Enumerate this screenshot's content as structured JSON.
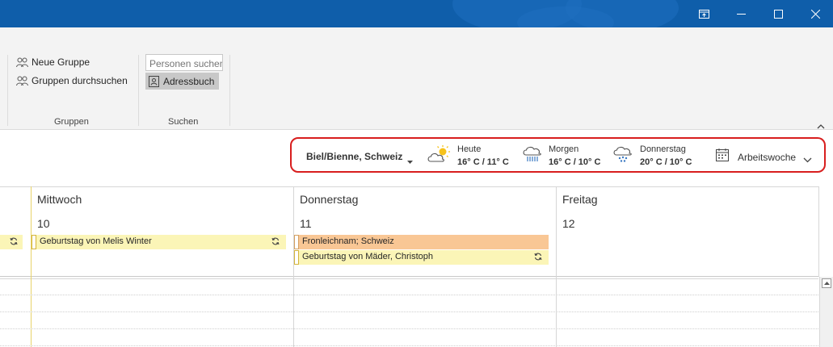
{
  "ribbon": {
    "new_group": "Neue Gruppe",
    "browse_groups": "Gruppen durchsuchen",
    "group_label_groups": "Gruppen",
    "search_people_placeholder": "Personen suchen",
    "address_book": "Adressbuch",
    "group_label_search": "Suchen"
  },
  "weather": {
    "location": "Biel/Bienne, Schweiz",
    "days": [
      {
        "label": "Heute",
        "temp": "16° C / 11° C",
        "icon": "sun-cloud-icon"
      },
      {
        "label": "Morgen",
        "temp": "16° C / 10° C",
        "icon": "rain-cloud-icon"
      },
      {
        "label": "Donnerstag",
        "temp": "20° C / 10° C",
        "icon": "shower-cloud-icon"
      }
    ],
    "view": "Arbeitswoche"
  },
  "calendar": {
    "days": [
      {
        "name": "Mittwoch",
        "number": "10"
      },
      {
        "name": "Donnerstag",
        "number": "11"
      },
      {
        "name": "Freitag",
        "number": "12"
      }
    ],
    "events": {
      "wed": "Geburtstag von Melis Winter",
      "thu_holiday": "Fronleichnam; Schweiz",
      "thu_birthday": "Geburtstag von Mäder, Christoph"
    }
  },
  "colors": {
    "titlebar": "#0f5eaa",
    "event_yellow": "#fbf5b7",
    "event_orange": "#f9c795",
    "highlight_border": "#d81e1e"
  }
}
